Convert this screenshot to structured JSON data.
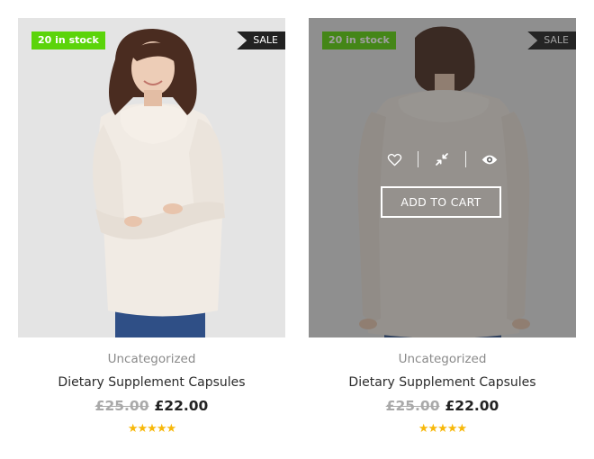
{
  "products": [
    {
      "stock_badge": "20 in stock",
      "sale_badge": "SALE",
      "category": "Uncategorized",
      "name": "Dietary Supplement Capsules",
      "old_price": "£25.00",
      "new_price": "£22.00",
      "stars": "★★★★★",
      "rating": 5,
      "image_icon": "model-front-sweater-photo"
    },
    {
      "stock_badge": "20 in stock",
      "sale_badge": "SALE",
      "category": "Uncategorized",
      "name": "Dietary Supplement Capsules",
      "old_price": "£25.00",
      "new_price": "£22.00",
      "stars": "★★★★★",
      "rating": 5,
      "image_icon": "model-back-sweater-photo",
      "hover_actions": {
        "wishlist_icon": "heart-icon",
        "compare_icon": "compress-arrows-icon",
        "quickview_icon": "eye-icon",
        "add_to_cart": "ADD TO CART"
      }
    }
  ],
  "colors": {
    "stock_badge": "#5bd40a",
    "sale_badge": "#222222",
    "stars": "#f7b80b",
    "old_price": "#a9a9a9",
    "category": "#8a8a8a"
  }
}
